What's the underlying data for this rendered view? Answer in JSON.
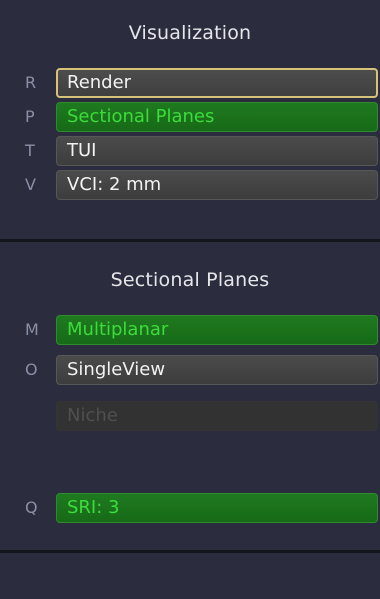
{
  "visualization": {
    "title": "Visualization",
    "items": [
      {
        "key": "R",
        "label": "Render"
      },
      {
        "key": "P",
        "label": "Sectional Planes"
      },
      {
        "key": "T",
        "label": "TUI"
      },
      {
        "key": "V",
        "label": "VCI: 2 mm"
      }
    ]
  },
  "sectional_planes": {
    "title": "Sectional Planes",
    "items": [
      {
        "key": "M",
        "label": "Multiplanar"
      },
      {
        "key": "O",
        "label": "SingleView"
      },
      {
        "key": "",
        "label": "Niche"
      },
      {
        "key": "Q",
        "label": "SRI: 3"
      }
    ]
  },
  "colors": {
    "background": "#2b2d3e",
    "active_green": "#3cdc3c",
    "focus_border": "#d7c27a"
  }
}
